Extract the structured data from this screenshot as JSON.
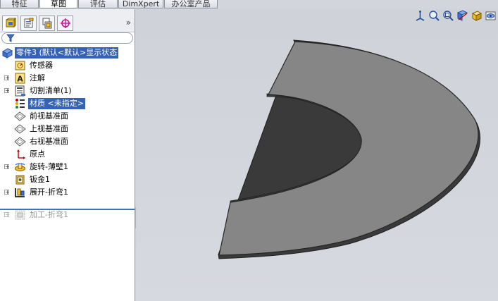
{
  "tabs": [
    {
      "label": "特征"
    },
    {
      "label": "草图",
      "active": true
    },
    {
      "label": "评估"
    },
    {
      "label": "DimXpert"
    },
    {
      "label": "办公室产品"
    }
  ],
  "panel_tabs": [
    {
      "icon": "feature-manager-icon"
    },
    {
      "icon": "property-manager-icon"
    },
    {
      "icon": "configuration-manager-icon"
    },
    {
      "icon": "dimxpert-manager-icon"
    }
  ],
  "panel_expand_glyph": "»",
  "filter_icon": "filter-icon",
  "tree": {
    "root": "零件3  (默认<默认>显示状态",
    "items": [
      {
        "label": "传感器",
        "icon": "sensor-icon",
        "expandable": false
      },
      {
        "label": "注解",
        "icon": "annotation-icon",
        "expandable": true
      },
      {
        "label": "切割清单(1)",
        "icon": "cut-list-icon",
        "expandable": true
      },
      {
        "label": "材质 <未指定>",
        "icon": "material-icon",
        "expandable": false,
        "selected": true
      },
      {
        "label": "前视基准面",
        "icon": "plane-icon",
        "expandable": false
      },
      {
        "label": "上视基准面",
        "icon": "plane-icon",
        "expandable": false
      },
      {
        "label": "右视基准面",
        "icon": "plane-icon",
        "expandable": false
      },
      {
        "label": "原点",
        "icon": "origin-icon",
        "expandable": false
      },
      {
        "label": "旋转-薄壁1",
        "icon": "revolve-icon",
        "expandable": true
      },
      {
        "label": "钣金1",
        "icon": "sheet-metal-icon",
        "expandable": false
      },
      {
        "label": "展开-折弯1",
        "icon": "unfold-icon",
        "expandable": true
      },
      {
        "label": "加工-折弯1",
        "icon": "process-bend-icon",
        "expandable": true,
        "suppressed": true
      }
    ]
  },
  "view_tools": [
    "view-orientation-icon",
    "zoom-fit-icon",
    "zoom-area-icon",
    "section-view-icon",
    "display-style-icon",
    "hide-show-icon"
  ],
  "colors": {
    "selection": "#3463b6",
    "rollback_bar": "#3c6fc6",
    "part_face": "#868686",
    "part_edge": "#2a2a2a",
    "viewport_bg": "#d2d5dc"
  }
}
